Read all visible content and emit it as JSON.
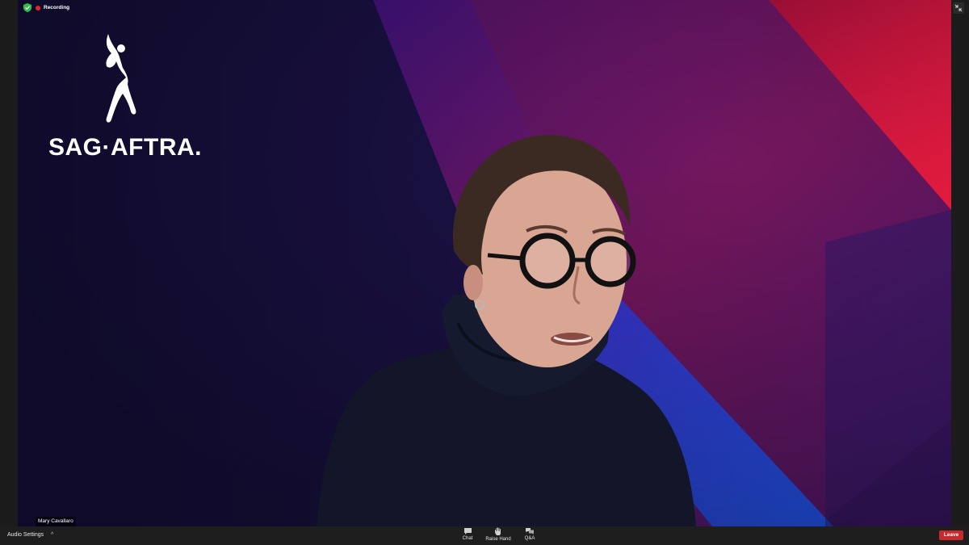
{
  "topbar": {
    "recording_label": "Recording",
    "security_icon": "shield-check-icon",
    "fullscreen_icon": "exit-fullscreen-icon"
  },
  "video": {
    "logo_text": "SAG·AFTRA.",
    "logo_icon": "sag-aftra-figure-logo",
    "participant_name": "Mary Cavallaro"
  },
  "toolbar": {
    "audio_settings_label": "Audio Settings",
    "audio_caret": "^",
    "tools": [
      {
        "label": "Chat",
        "icon": "chat-icon"
      },
      {
        "label": "Raise Hand",
        "icon": "raise-hand-icon"
      },
      {
        "label": "Q&A",
        "icon": "qa-icon"
      }
    ],
    "leave_label": "Leave"
  },
  "colors": {
    "recording_red": "#e02828",
    "leave_red": "#c72a2a",
    "toolbar_bg": "#1e1e1e",
    "secure_green": "#2fbf4a"
  }
}
